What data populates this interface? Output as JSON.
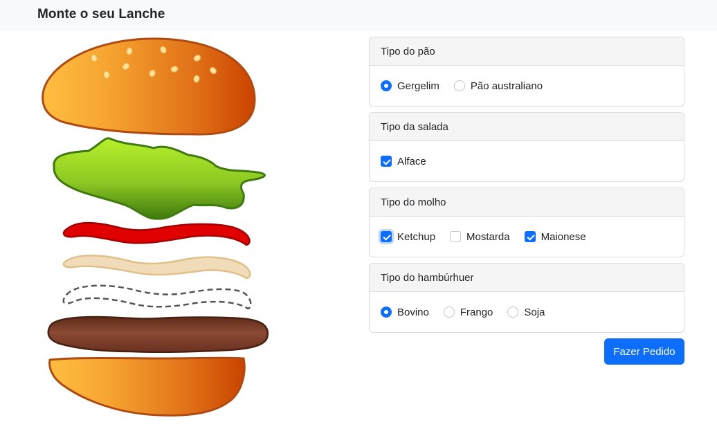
{
  "header": {
    "title": "Monte o seu Lanche"
  },
  "sections": [
    {
      "title": "Tipo do pão",
      "type": "radio",
      "options": [
        {
          "label": "Gergelim",
          "checked": true
        },
        {
          "label": "Pão australiano",
          "checked": false
        }
      ]
    },
    {
      "title": "Tipo da salada",
      "type": "checkbox",
      "options": [
        {
          "label": "Alface",
          "checked": true
        }
      ]
    },
    {
      "title": "Tipo do molho",
      "type": "checkbox",
      "options": [
        {
          "label": "Ketchup",
          "checked": true,
          "focused": true
        },
        {
          "label": "Mostarda",
          "checked": false
        },
        {
          "label": "Maionese",
          "checked": true
        }
      ]
    },
    {
      "title": "Tipo do hambúrhuer",
      "type": "radio",
      "options": [
        {
          "label": "Bovino",
          "checked": true
        },
        {
          "label": "Frango",
          "checked": false
        },
        {
          "label": "Soja",
          "checked": false
        }
      ]
    }
  ],
  "submit": {
    "label": "Fazer Pedido"
  },
  "colors": {
    "accent": "#0d6efd",
    "bun_light": "#ffbe40",
    "bun_dark": "#c94400",
    "lettuce": "#9acd2a",
    "ketchup": "#e00000",
    "mayo": "#f0dcb8",
    "patty": "#7a3b24"
  },
  "illustration": {
    "layers": [
      "bun-top",
      "lettuce",
      "ketchup",
      "mayonnaise",
      "mustard-placeholder",
      "patty",
      "bun-bottom"
    ]
  }
}
